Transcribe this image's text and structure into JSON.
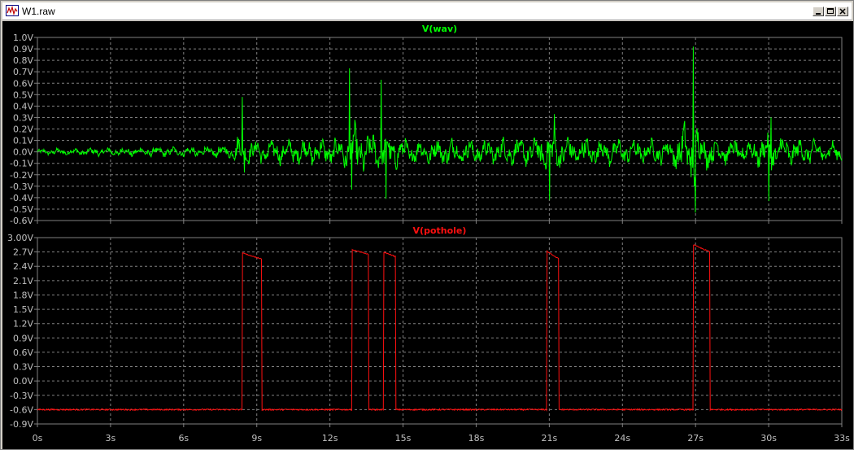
{
  "window": {
    "title": "W1.raw",
    "controls": [
      "minimize",
      "maximize",
      "close"
    ]
  },
  "colors": {
    "background": "#000000",
    "grid": "#808080",
    "axis_text": "#c0c0c0",
    "wav_trace": "#00ff00",
    "pothole_trace": "#ff1010"
  },
  "chart_data": [
    {
      "type": "line",
      "title": "V(wav)",
      "series": [
        {
          "name": "V(wav)",
          "color": "#00ff00"
        }
      ],
      "xlim": [
        0,
        33
      ],
      "ylim": [
        -0.6,
        1.0
      ],
      "x_ticks": [
        "0s",
        "3s",
        "6s",
        "9s",
        "12s",
        "15s",
        "18s",
        "21s",
        "24s",
        "27s",
        "30s",
        "33s"
      ],
      "y_ticks": [
        "1.0V",
        "0.9V",
        "0.8V",
        "0.7V",
        "0.6V",
        "0.5V",
        "0.4V",
        "0.3V",
        "0.2V",
        "0.1V",
        "0.0V",
        "-0.1V",
        "-0.2V",
        "-0.3V",
        "-0.4V",
        "-0.5V",
        "-0.6V"
      ],
      "grid": true,
      "noise_envelope": {
        "x": [
          0,
          2,
          4,
          6,
          8,
          8.2,
          8.4,
          9,
          10,
          11,
          12,
          12.5,
          13,
          13.5,
          14,
          14.3,
          15,
          16,
          17,
          18,
          19,
          20,
          21,
          22,
          23,
          24,
          25,
          26,
          26.6,
          26.9,
          27.2,
          28,
          29,
          29.8,
          30.2,
          31,
          32,
          33
        ],
        "amplitude": [
          0.03,
          0.04,
          0.05,
          0.05,
          0.07,
          0.16,
          0.12,
          0.13,
          0.12,
          0.13,
          0.14,
          0.16,
          0.28,
          0.2,
          0.18,
          0.2,
          0.14,
          0.13,
          0.14,
          0.13,
          0.14,
          0.14,
          0.2,
          0.15,
          0.14,
          0.13,
          0.12,
          0.14,
          0.3,
          0.45,
          0.2,
          0.13,
          0.12,
          0.16,
          0.2,
          0.14,
          0.12,
          0.1
        ]
      },
      "peaks": [
        {
          "x": 8.4,
          "y": 0.48
        },
        {
          "x": 8.5,
          "y": -0.18
        },
        {
          "x": 12.8,
          "y": 0.73
        },
        {
          "x": 12.9,
          "y": -0.33
        },
        {
          "x": 14.1,
          "y": 0.63
        },
        {
          "x": 14.3,
          "y": -0.41
        },
        {
          "x": 21.0,
          "y": -0.42
        },
        {
          "x": 21.2,
          "y": 0.33
        },
        {
          "x": 26.9,
          "y": 0.92
        },
        {
          "x": 27.0,
          "y": -0.53
        },
        {
          "x": 30.0,
          "y": -0.43
        },
        {
          "x": 30.1,
          "y": 0.3
        }
      ]
    },
    {
      "type": "line",
      "title": "V(pothole)",
      "series": [
        {
          "name": "V(pothole)",
          "color": "#ff1010"
        }
      ],
      "xlim": [
        0,
        33
      ],
      "ylim": [
        -0.9,
        3.0
      ],
      "x_ticks": [
        "0s",
        "3s",
        "6s",
        "9s",
        "12s",
        "15s",
        "18s",
        "21s",
        "24s",
        "27s",
        "30s",
        "33s"
      ],
      "y_ticks": [
        "3.00V",
        "2.7V",
        "2.4V",
        "2.1V",
        "1.8V",
        "1.5V",
        "1.2V",
        "0.9V",
        "0.6V",
        "0.3V",
        "0.0V",
        "-0.3V",
        "-0.6V",
        "-0.9V"
      ],
      "grid": true,
      "baseline": -0.6,
      "pulses": [
        {
          "start": 8.4,
          "end": 9.2,
          "high_start": 2.68,
          "high_end": 2.55
        },
        {
          "start": 12.9,
          "end": 13.6,
          "high_start": 2.75,
          "high_end": 2.65
        },
        {
          "start": 14.2,
          "end": 14.7,
          "high_start": 2.7,
          "high_end": 2.6
        },
        {
          "start": 20.9,
          "end": 21.4,
          "high_start": 2.72,
          "high_end": 2.55
        },
        {
          "start": 26.9,
          "end": 27.6,
          "high_start": 2.85,
          "high_end": 2.7
        }
      ]
    }
  ]
}
